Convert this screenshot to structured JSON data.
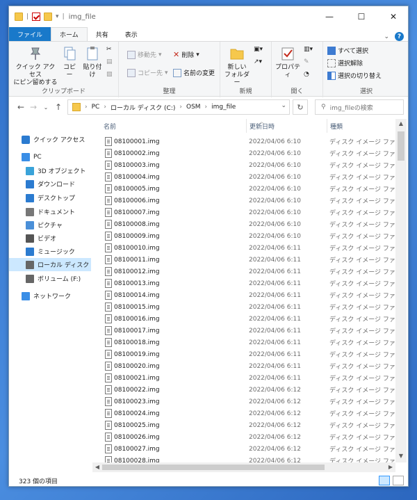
{
  "window": {
    "title": "img_file",
    "controls": [
      "—",
      "☐",
      "✕"
    ]
  },
  "tabs": [
    {
      "label": "ファイル"
    },
    {
      "label": "ホーム"
    },
    {
      "label": "共有"
    },
    {
      "label": "表示"
    }
  ],
  "ribbon": {
    "clipboard": {
      "label": "クリップボード",
      "quick_access_pin": "クイック アクセス\nにピン留めする",
      "copy": "コピー",
      "paste": "貼り付け"
    },
    "organize": {
      "label": "整理",
      "move_to": "移動先",
      "copy_to": "コピー先",
      "delete": "削除",
      "rename": "名前の変更"
    },
    "new": {
      "label": "新規",
      "new_folder": "新しい\nフォルダー"
    },
    "open": {
      "label": "開く",
      "properties": "プロパティ"
    },
    "select": {
      "label": "選択",
      "select_all": "すべて選択",
      "select_none": "選択解除",
      "invert_selection": "選択の切り替え"
    }
  },
  "address": {
    "crumbs": [
      "PC",
      "ローカル ディスク (C:)",
      "OSM",
      "img_file"
    ],
    "search_placeholder": "img_fileの検索"
  },
  "nav": {
    "items": [
      {
        "label": "クイック アクセス",
        "icon": "star-icon"
      },
      {
        "label": "PC",
        "icon": "computer-icon"
      },
      {
        "label": "3D オブジェクト",
        "icon": "cube-icon"
      },
      {
        "label": "ダウンロード",
        "icon": "download-icon"
      },
      {
        "label": "デスクトップ",
        "icon": "desktop-icon"
      },
      {
        "label": "ドキュメント",
        "icon": "document-icon"
      },
      {
        "label": "ピクチャ",
        "icon": "picture-icon"
      },
      {
        "label": "ビデオ",
        "icon": "video-icon"
      },
      {
        "label": "ミュージック",
        "icon": "music-icon"
      },
      {
        "label": "ローカル ディスク (C:)",
        "icon": "drive-icon"
      },
      {
        "label": "ボリューム (F:)",
        "icon": "drive-icon"
      },
      {
        "label": "ネットワーク",
        "icon": "network-icon"
      }
    ]
  },
  "columns": {
    "name": "名前",
    "date": "更新日時",
    "type": "種類"
  },
  "files": [
    {
      "name": "08100001.img",
      "date": "2022/04/06 6:10",
      "type": "ディスク イメージ ファ..."
    },
    {
      "name": "08100002.img",
      "date": "2022/04/06 6:10",
      "type": "ディスク イメージ ファ..."
    },
    {
      "name": "08100003.img",
      "date": "2022/04/06 6:10",
      "type": "ディスク イメージ ファ..."
    },
    {
      "name": "08100004.img",
      "date": "2022/04/06 6:10",
      "type": "ディスク イメージ ファ..."
    },
    {
      "name": "08100005.img",
      "date": "2022/04/06 6:10",
      "type": "ディスク イメージ ファ..."
    },
    {
      "name": "08100006.img",
      "date": "2022/04/06 6:10",
      "type": "ディスク イメージ ファ..."
    },
    {
      "name": "08100007.img",
      "date": "2022/04/06 6:10",
      "type": "ディスク イメージ ファ..."
    },
    {
      "name": "08100008.img",
      "date": "2022/04/06 6:10",
      "type": "ディスク イメージ ファ..."
    },
    {
      "name": "08100009.img",
      "date": "2022/04/06 6:10",
      "type": "ディスク イメージ ファ..."
    },
    {
      "name": "08100010.img",
      "date": "2022/04/06 6:11",
      "type": "ディスク イメージ ファ..."
    },
    {
      "name": "08100011.img",
      "date": "2022/04/06 6:11",
      "type": "ディスク イメージ ファ..."
    },
    {
      "name": "08100012.img",
      "date": "2022/04/06 6:11",
      "type": "ディスク イメージ ファ..."
    },
    {
      "name": "08100013.img",
      "date": "2022/04/06 6:11",
      "type": "ディスク イメージ ファ..."
    },
    {
      "name": "08100014.img",
      "date": "2022/04/06 6:11",
      "type": "ディスク イメージ ファ..."
    },
    {
      "name": "08100015.img",
      "date": "2022/04/06 6:11",
      "type": "ディスク イメージ ファ..."
    },
    {
      "name": "08100016.img",
      "date": "2022/04/06 6:11",
      "type": "ディスク イメージ ファ..."
    },
    {
      "name": "08100017.img",
      "date": "2022/04/06 6:11",
      "type": "ディスク イメージ ファ..."
    },
    {
      "name": "08100018.img",
      "date": "2022/04/06 6:11",
      "type": "ディスク イメージ ファ..."
    },
    {
      "name": "08100019.img",
      "date": "2022/04/06 6:11",
      "type": "ディスク イメージ ファ..."
    },
    {
      "name": "08100020.img",
      "date": "2022/04/06 6:11",
      "type": "ディスク イメージ ファ..."
    },
    {
      "name": "08100021.img",
      "date": "2022/04/06 6:11",
      "type": "ディスク イメージ ファ..."
    },
    {
      "name": "08100022.img",
      "date": "2022/04/06 6:12",
      "type": "ディスク イメージ ファ..."
    },
    {
      "name": "08100023.img",
      "date": "2022/04/06 6:12",
      "type": "ディスク イメージ ファ..."
    },
    {
      "name": "08100024.img",
      "date": "2022/04/06 6:12",
      "type": "ディスク イメージ ファ..."
    },
    {
      "name": "08100025.img",
      "date": "2022/04/06 6:12",
      "type": "ディスク イメージ ファ..."
    },
    {
      "name": "08100026.img",
      "date": "2022/04/06 6:12",
      "type": "ディスク イメージ ファ..."
    },
    {
      "name": "08100027.img",
      "date": "2022/04/06 6:12",
      "type": "ディスク イメージ ファ..."
    },
    {
      "name": "08100028.img",
      "date": "2022/04/06 6:12",
      "type": "ディスク イメージ ファ..."
    }
  ],
  "status": {
    "count": "323 個の項目"
  },
  "colors": {
    "accent": "#1979ca",
    "selection": "#cce8ff"
  }
}
